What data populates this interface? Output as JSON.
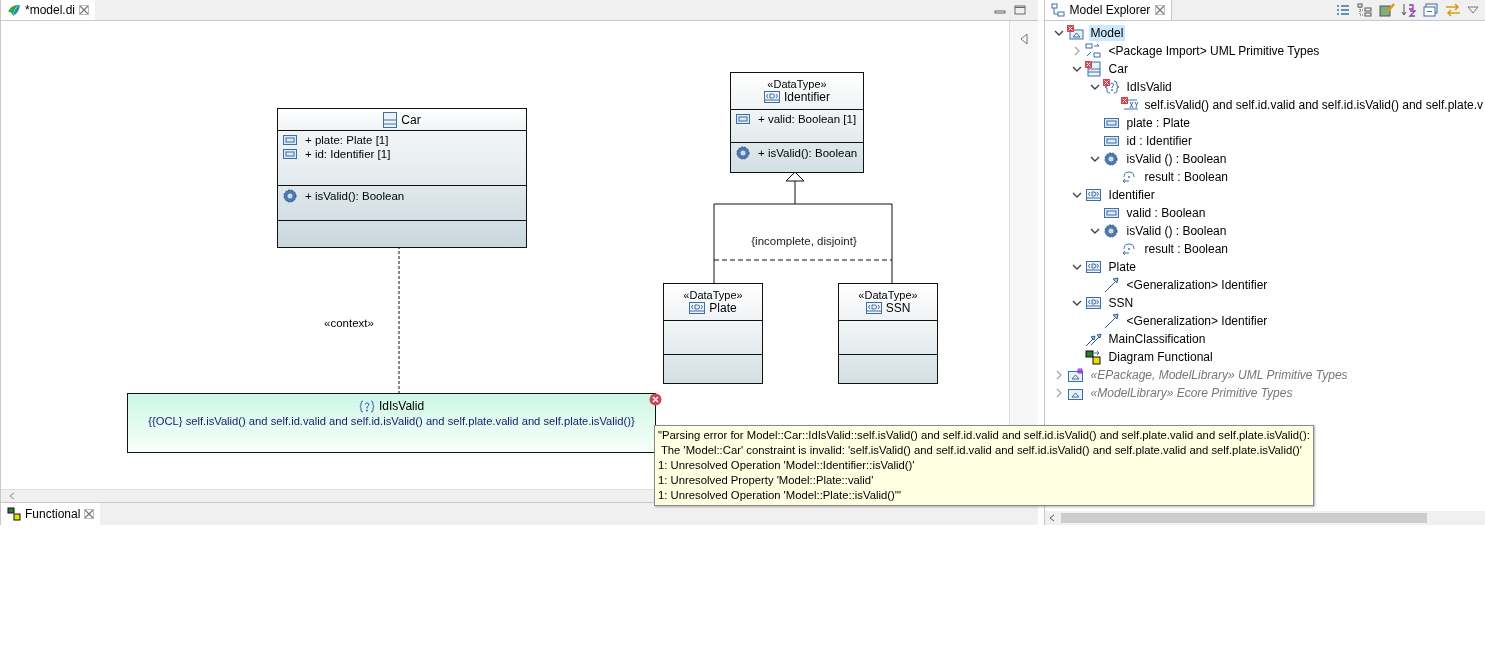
{
  "editor": {
    "tabs": [
      {
        "label": "*model.di",
        "selected": true
      }
    ],
    "diagram": {
      "classes": [
        {
          "kind": "class",
          "name": "Car",
          "attributes": [
            "+ plate: Plate [1]",
            "+ id: Identifier [1]"
          ],
          "operations": [
            "+ isValid(): Boolean"
          ]
        },
        {
          "kind": "datatype",
          "stereotype": "«DataType»",
          "name": "Identifier",
          "attributes": [
            "+ valid: Boolean [1]"
          ],
          "operations": [
            "+ isValid(): Boolean"
          ]
        },
        {
          "kind": "datatype",
          "stereotype": "«DataType»",
          "name": "Plate"
        },
        {
          "kind": "datatype",
          "stereotype": "«DataType»",
          "name": "SSN"
        }
      ],
      "generalization_set_label": "{incomplete, disjoint}",
      "context_label": "«context»",
      "constraint": {
        "name": "IdIsValid",
        "body": "{{OCL} self.isValid() and self.id.valid and self.id.isValid() and self.plate.valid and self.plate.isValid()}",
        "error": true
      },
      "error_tooltip": [
        "\"Parsing error for Model::Car::IdIsValid::self.isValid() and self.id.valid and self.id.isValid() and self.plate.valid and self.plate.isValid():",
        " The 'Model::Car' constraint is invalid: 'self.isValid() and self.id.valid and self.id.isValid() and self.plate.valid and self.plate.isValid()'",
        "1: Unresolved Operation 'Model::Identifier::isValid()'",
        "1: Unresolved Property 'Model::Plate::valid'",
        "1: Unresolved Operation 'Model::Plate::isValid()'\""
      ]
    },
    "bottom_tabs": [
      {
        "label": "Functional",
        "selected": true
      }
    ]
  },
  "explorer": {
    "title": "Model Explorer",
    "tree": [
      {
        "kind": "model",
        "label": "Model",
        "error": true,
        "selected": true,
        "expanded": true,
        "children": [
          {
            "kind": "package-import",
            "label": "<Package Import> UML Primitive Types",
            "selected": false,
            "expanded": false
          },
          {
            "kind": "class",
            "label": "Car",
            "error": true,
            "selected": false,
            "expanded": true,
            "children": [
              {
                "kind": "constraint",
                "label": "IdIsValid",
                "error": true,
                "selected": false,
                "expanded": true,
                "children": [
                  {
                    "kind": "specification",
                    "label": "self.isValid() and self.id.valid and self.id.isValid() and self.plate.v",
                    "error": true,
                    "selected": false
                  }
                ]
              },
              {
                "kind": "property",
                "label": "plate : Plate",
                "selected": false
              },
              {
                "kind": "property",
                "label": "id : Identifier",
                "selected": false
              },
              {
                "kind": "operation",
                "label": "isValid () : Boolean",
                "selected": false,
                "expanded": true,
                "children": [
                  {
                    "kind": "parameter",
                    "label": "result : Boolean",
                    "selected": false
                  }
                ]
              }
            ]
          },
          {
            "kind": "datatype",
            "label": "Identifier",
            "selected": false,
            "expanded": true,
            "children": [
              {
                "kind": "property",
                "label": "valid : Boolean",
                "selected": false
              },
              {
                "kind": "operation",
                "label": "isValid () : Boolean",
                "selected": false,
                "expanded": true,
                "children": [
                  {
                    "kind": "parameter",
                    "label": "result : Boolean",
                    "selected": false
                  }
                ]
              }
            ]
          },
          {
            "kind": "datatype",
            "label": "Plate",
            "selected": false,
            "expanded": true,
            "children": [
              {
                "kind": "generalization",
                "label": "<Generalization> Identifier",
                "selected": false
              }
            ]
          },
          {
            "kind": "datatype",
            "label": "SSN",
            "selected": false,
            "expanded": true,
            "children": [
              {
                "kind": "generalization",
                "label": "<Generalization> Identifier",
                "selected": false
              }
            ]
          },
          {
            "kind": "generalization-set",
            "label": "MainClassification",
            "selected": false
          },
          {
            "kind": "diagram",
            "label": "Diagram Functional",
            "selected": false
          }
        ]
      },
      {
        "kind": "library-epackage",
        "label": "«EPackage, ModelLibrary» UML Primitive Types",
        "selected": false,
        "expanded": false
      },
      {
        "kind": "library",
        "label": "«ModelLibrary» Ecore Primitive Types",
        "selected": false,
        "expanded": false
      }
    ]
  }
}
